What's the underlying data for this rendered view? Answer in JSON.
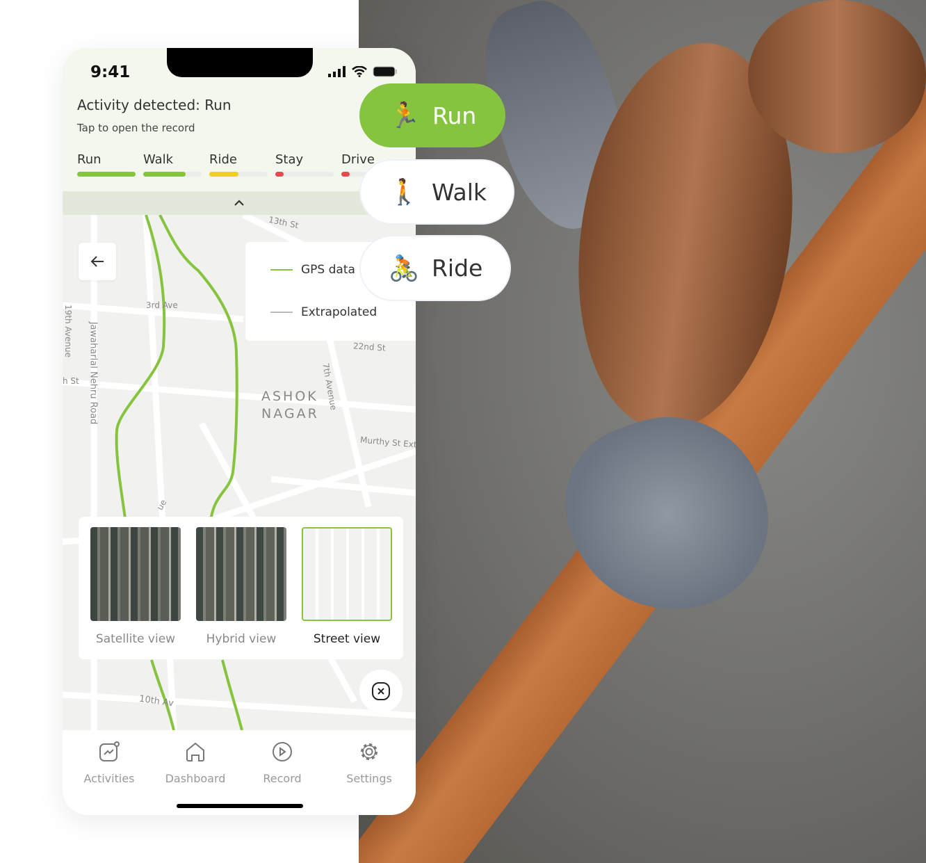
{
  "status_bar": {
    "time": "9:41"
  },
  "notification": {
    "title": "Activity detected: Run",
    "subtitle": "Tap to open the record"
  },
  "activities": [
    {
      "label": "Run",
      "level": 1.0,
      "color": "#86c440"
    },
    {
      "label": "Walk",
      "level": 0.73,
      "color": "#86c440"
    },
    {
      "label": "Ride",
      "level": 0.5,
      "color": "#f2cf1f"
    },
    {
      "label": "Stay",
      "level": 0.14,
      "color": "#e24a4f"
    },
    {
      "label": "Drive",
      "level": 0.14,
      "color": "#e24a4f"
    }
  ],
  "map": {
    "labels": [
      "13th St",
      "3rd Ave",
      "19th Avenue",
      "Jawaharlal Nehru Road",
      "h St",
      "ASHOK",
      "NAGAR",
      "7th Avenue",
      "Murthy St Ext",
      "22nd St",
      "10th Av",
      "ue"
    ]
  },
  "legend": {
    "gps": "GPS data",
    "gps_color": "#86c440",
    "extrapolated": "Extrapolated",
    "extrapolated_color": "#bbbbbb"
  },
  "views": [
    {
      "label": "Satellite view"
    },
    {
      "label": "Hybrid view"
    },
    {
      "label": "Street view",
      "selected": true
    }
  ],
  "nav": [
    {
      "label": "Activities",
      "icon": "activities-icon"
    },
    {
      "label": "Dashboard",
      "icon": "home-icon"
    },
    {
      "label": "Record",
      "icon": "play-icon"
    },
    {
      "label": "Settings",
      "icon": "gear-icon"
    }
  ],
  "pills": [
    {
      "label": "Run",
      "emoji": "🏃",
      "active": true
    },
    {
      "label": "Walk",
      "emoji": "🚶"
    },
    {
      "label": "Ride",
      "emoji": "🚴"
    }
  ],
  "accent": "#86c440"
}
